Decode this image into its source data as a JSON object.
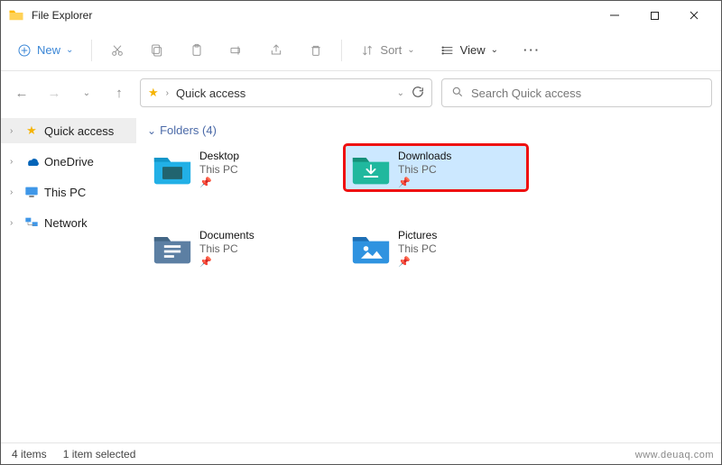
{
  "window": {
    "title": "File Explorer"
  },
  "toolbar": {
    "new_label": "New",
    "sort_label": "Sort",
    "view_label": "View"
  },
  "address": {
    "location": "Quick access"
  },
  "search": {
    "placeholder": "Search Quick access"
  },
  "sidebar": {
    "quick_access": "Quick access",
    "onedrive": "OneDrive",
    "this_pc": "This PC",
    "network": "Network"
  },
  "section": {
    "folders_label": "Folders (4)"
  },
  "folders": [
    {
      "name": "Desktop",
      "loc": "This PC"
    },
    {
      "name": "Downloads",
      "loc": "This PC"
    },
    {
      "name": "Documents",
      "loc": "This PC"
    },
    {
      "name": "Pictures",
      "loc": "This PC"
    }
  ],
  "status": {
    "count": "4 items",
    "selected": "1 item selected"
  },
  "watermark": "www.deuaq.com"
}
